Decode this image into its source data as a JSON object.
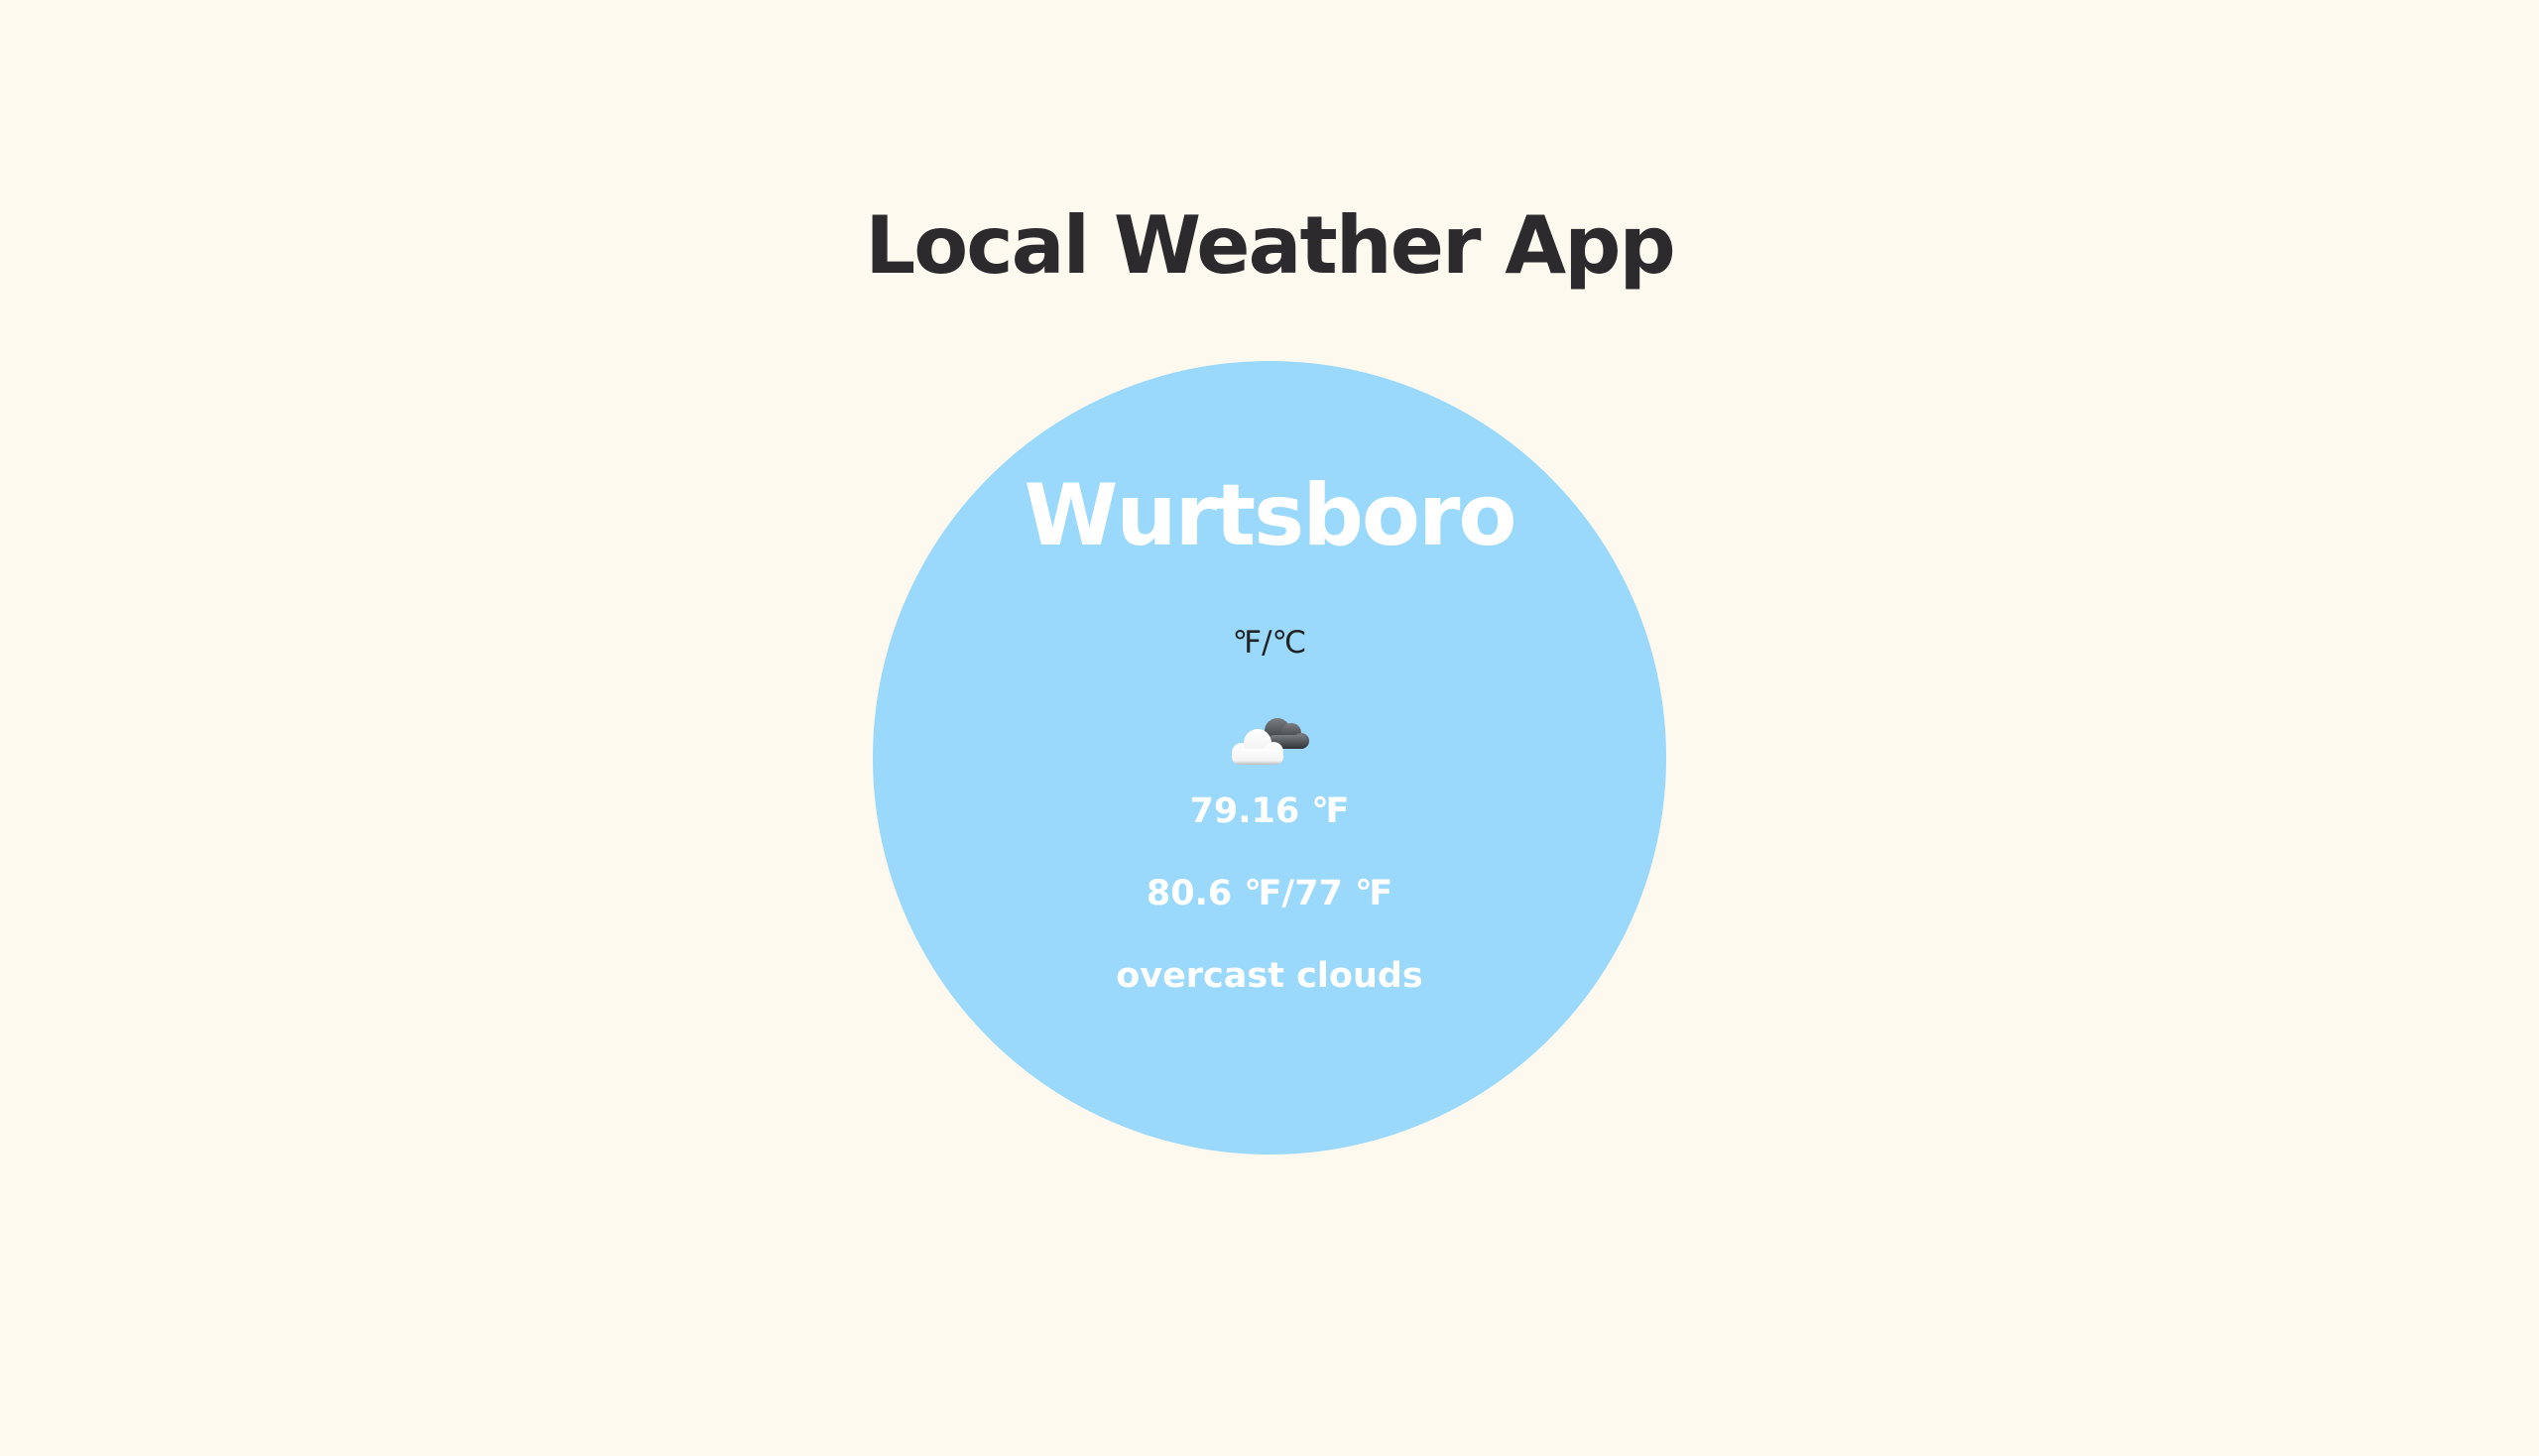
{
  "app": {
    "title": "Local Weather App"
  },
  "weather": {
    "city": "Wurtsboro",
    "unit_toggle_label": "℉/℃",
    "icon": "overcast-cloud-icon",
    "current_temp": "79.16 ℉",
    "temp_range": "80.6 ℉/77 ℉",
    "description": "overcast clouds"
  },
  "colors": {
    "background": "#fdf9ef",
    "circle": "#9ad9fb",
    "title_text": "#2d2a2e",
    "weather_text": "#ffffff"
  }
}
